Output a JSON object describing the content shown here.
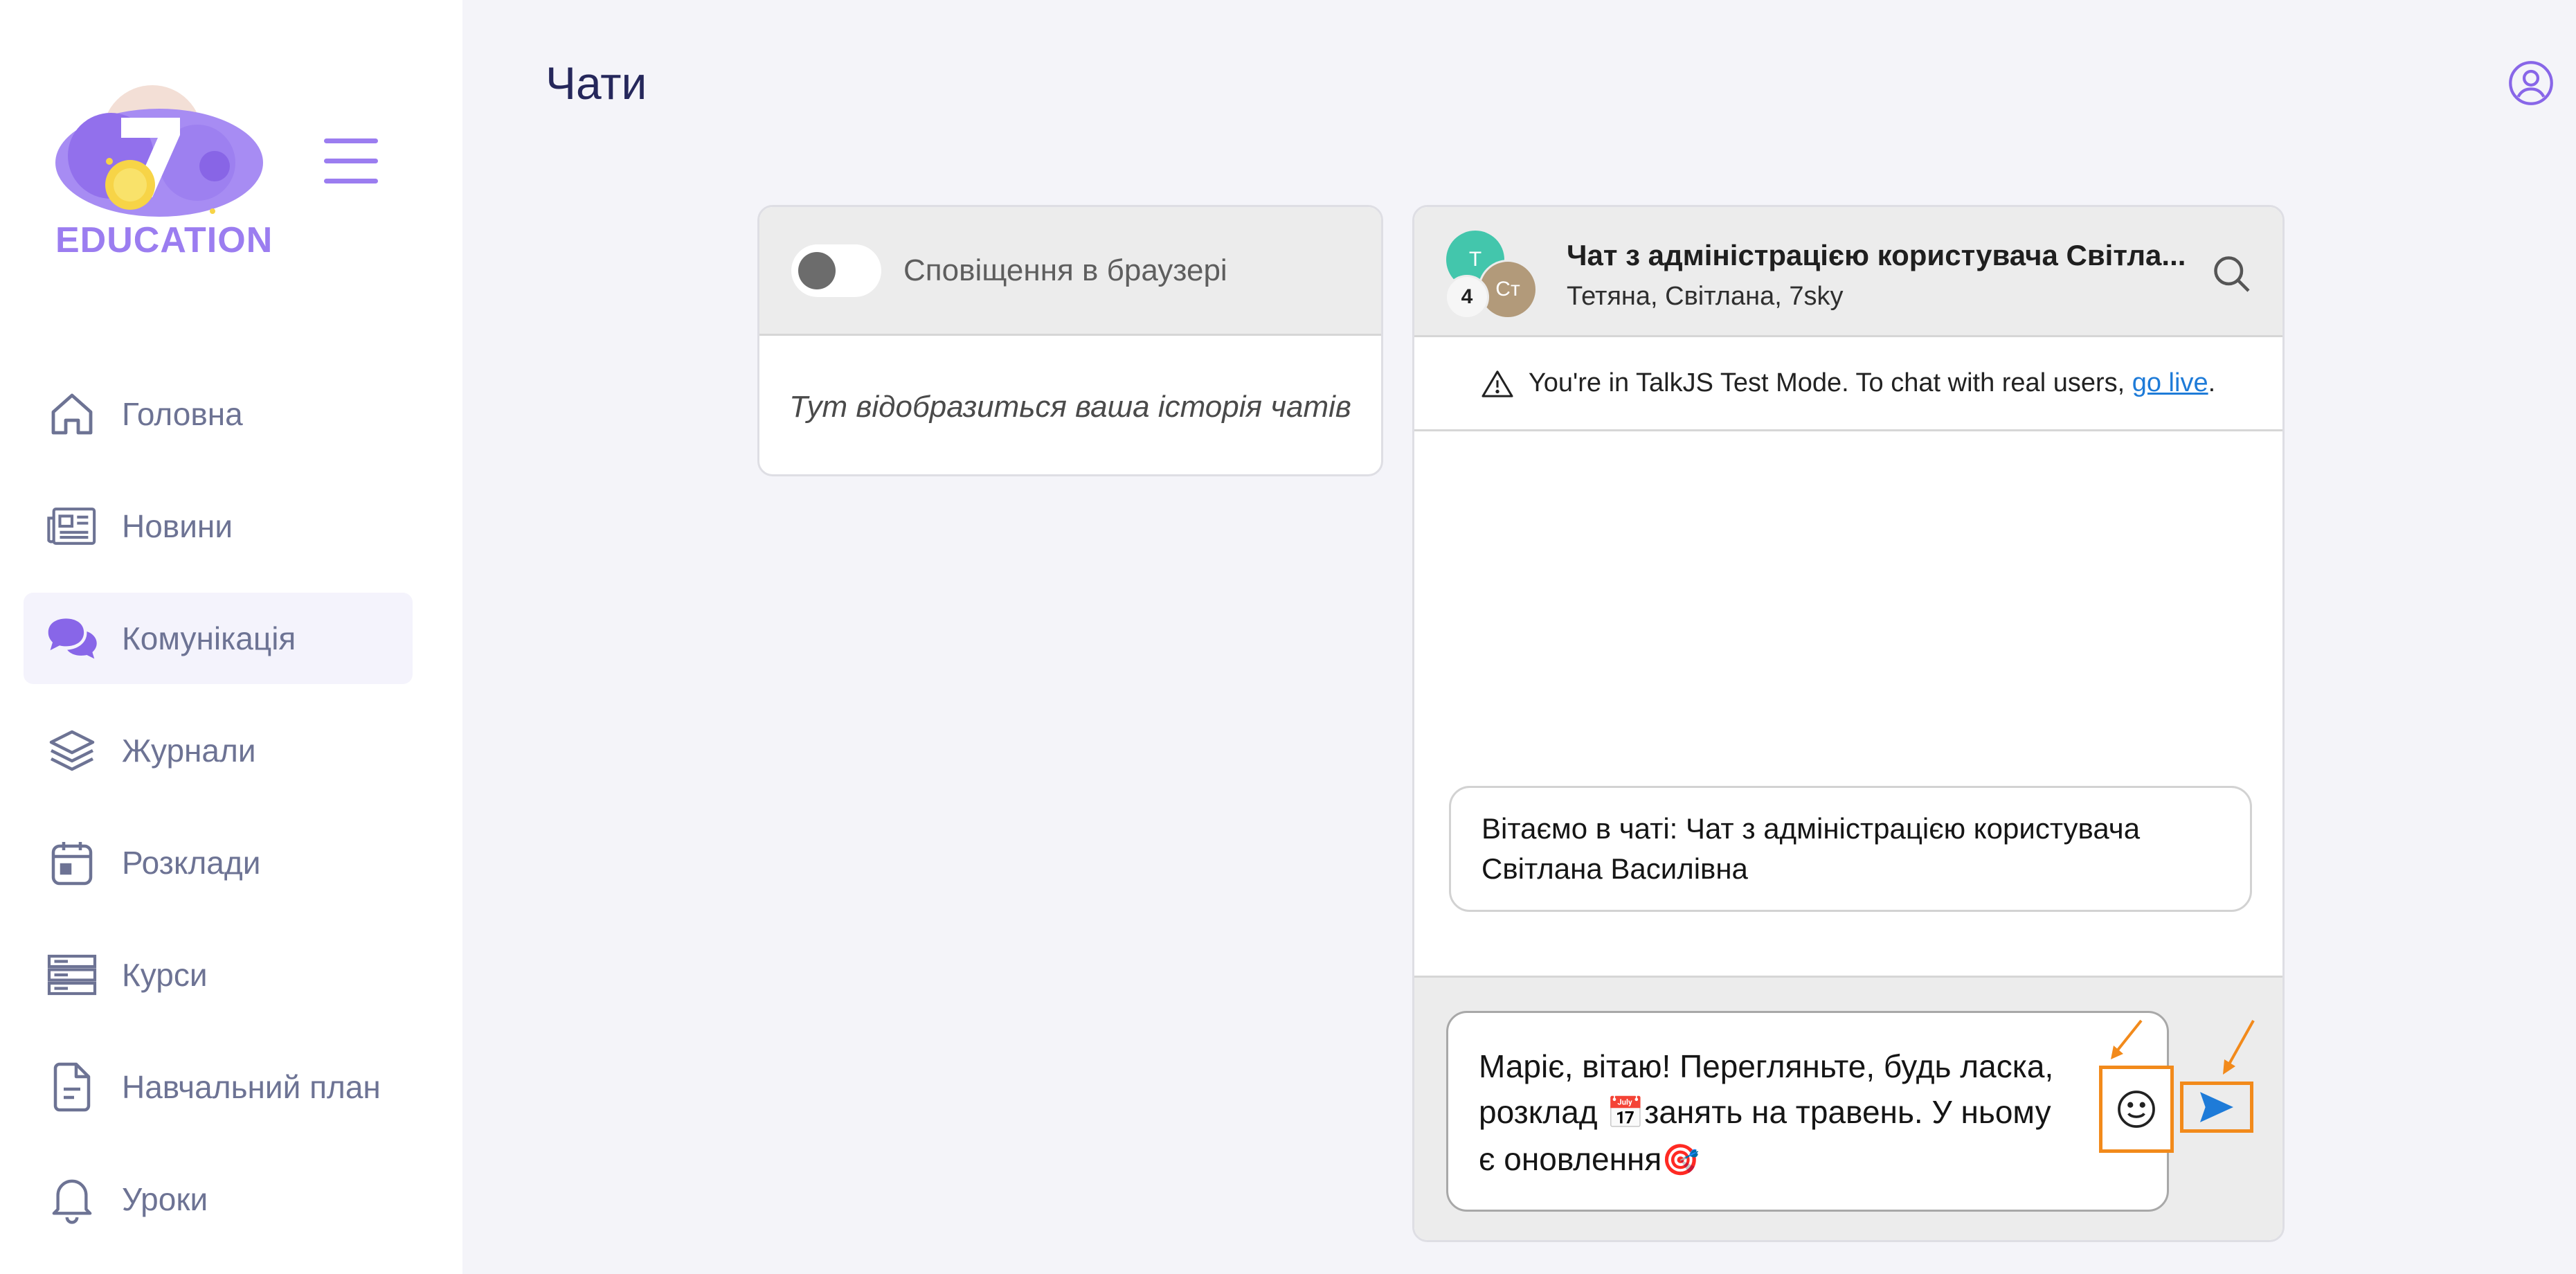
{
  "brand": {
    "logo_text": "EDUCATION",
    "accent": "#9b7df0"
  },
  "sidebar": {
    "items": [
      {
        "label": "Головна",
        "icon": "home-icon"
      },
      {
        "label": "Новини",
        "icon": "news-icon"
      },
      {
        "label": "Комунікація",
        "icon": "chat-bubbles-icon",
        "active": true
      },
      {
        "label": "Журнали",
        "icon": "layers-icon"
      },
      {
        "label": "Розклади",
        "icon": "calendar-icon"
      },
      {
        "label": "Курси",
        "icon": "server-icon"
      },
      {
        "label": "Навчальний план",
        "icon": "document-icon"
      },
      {
        "label": "Уроки",
        "icon": "bell-icon"
      }
    ]
  },
  "page": {
    "title": "Чати"
  },
  "notifications": {
    "label": "Сповіщення в браузері",
    "enabled": false
  },
  "history": {
    "empty_text": "Тут відобразиться ваша історія чатів"
  },
  "chat": {
    "avatar_t": "Т",
    "avatar_st": "Ст",
    "participant_count": "4",
    "title": "Чат з адміністрацією користувача Світла...",
    "subtitle": "Тетяна, Світлана, 7sky",
    "banner_text": "You're in TalkJS Test Mode. To chat with real users, ",
    "banner_link": "go live",
    "banner_end": ".",
    "welcome": "Вітаємо в чаті: Чат з адміністрацією користувача Світлана Василівна",
    "composer_part1": "Маріє, вітаю! Перегляньте, будь ласка, розклад ",
    "composer_emoji1": "📅",
    "composer_part2": "занять на травень. У ньому є оновлення",
    "composer_emoji2": "🎯"
  },
  "colors": {
    "annotation": "#f28a1b",
    "send": "#1e7bd8",
    "text_dark": "#25275b",
    "nav_text": "#6d7394"
  }
}
